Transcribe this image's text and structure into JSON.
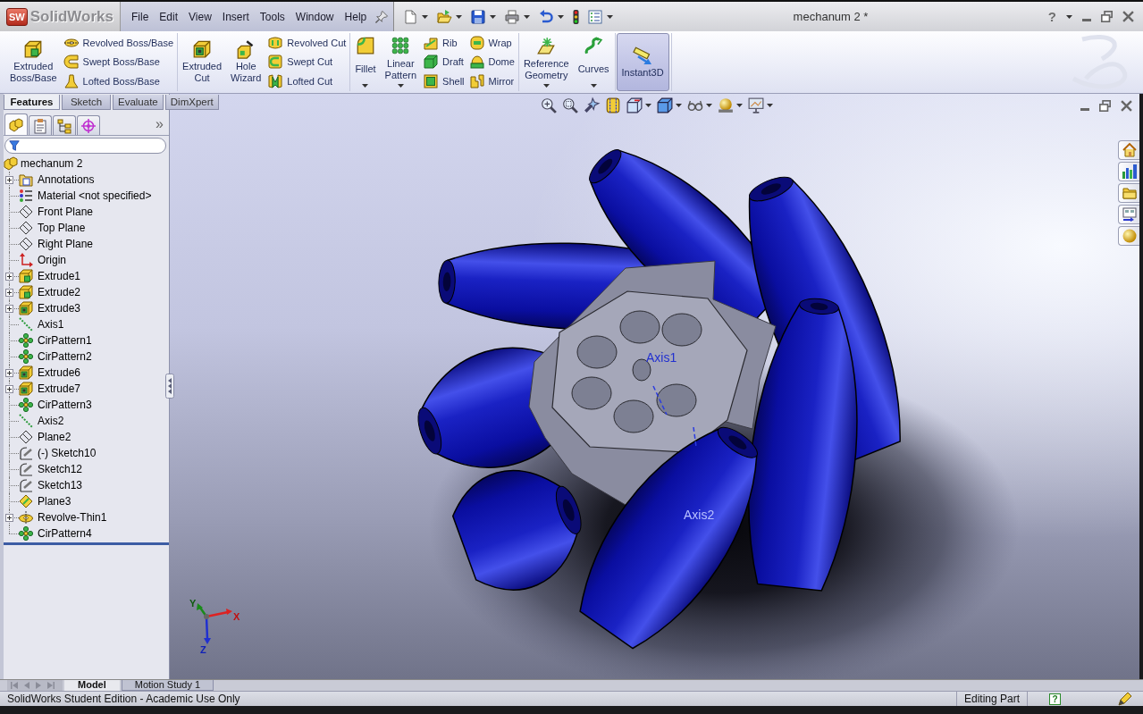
{
  "app": {
    "logo_mark": "SW",
    "logo": "SolidWorks"
  },
  "menu": [
    "File",
    "Edit",
    "View",
    "Insert",
    "Tools",
    "Window",
    "Help"
  ],
  "window": {
    "title": "mechanum 2 *",
    "help_glyph": "?"
  },
  "ribbon": {
    "groups": [
      {
        "columns": [
          {
            "kind": "large",
            "label": "Extruded Boss/Base",
            "dropdown": false,
            "active": false
          },
          {
            "kind": "stack",
            "items": [
              "Revolved Boss/Base",
              "Swept Boss/Base",
              "Lofted Boss/Base"
            ]
          }
        ]
      },
      {
        "columns": [
          {
            "kind": "large",
            "label": "Extruded Cut",
            "dropdown": false,
            "active": false
          },
          {
            "kind": "large",
            "label": "Hole Wizard",
            "dropdown": false,
            "active": false
          },
          {
            "kind": "stack",
            "items": [
              "Revolved Cut",
              "Swept Cut",
              "Lofted Cut"
            ]
          }
        ]
      },
      {
        "columns": [
          {
            "kind": "large",
            "label": "Fillet",
            "dropdown": true,
            "active": false
          },
          {
            "kind": "large",
            "label": "Linear Pattern",
            "dropdown": true,
            "active": false
          },
          {
            "kind": "stack",
            "items": [
              "Rib",
              "Draft",
              "Shell"
            ]
          },
          {
            "kind": "stack",
            "items": [
              "Wrap",
              "Dome",
              "Mirror"
            ]
          }
        ]
      },
      {
        "columns": [
          {
            "kind": "large",
            "label": "Reference Geometry",
            "dropdown": true,
            "active": false
          },
          {
            "kind": "large",
            "label": "Curves",
            "dropdown": true,
            "active": false
          }
        ]
      },
      {
        "columns": [
          {
            "kind": "large",
            "label": "Instant3D",
            "dropdown": false,
            "active": true
          }
        ]
      }
    ]
  },
  "command_tabs": [
    {
      "label": "Features",
      "selected": true
    },
    {
      "label": "Sketch",
      "selected": false
    },
    {
      "label": "Evaluate",
      "selected": false
    },
    {
      "label": "DimXpert",
      "selected": false
    }
  ],
  "feature_panel": {
    "tabs": [
      {
        "selected": true
      },
      {
        "selected": false
      },
      {
        "selected": false
      },
      {
        "selected": false
      }
    ],
    "more_glyph": "»",
    "tree": {
      "label": "mechanum 2",
      "children": [
        {
          "label": "Annotations",
          "kind": "annotations",
          "expandable": true
        },
        {
          "label": "Material <not specified>",
          "kind": "material",
          "expandable": false
        },
        {
          "label": "Front Plane",
          "kind": "plane",
          "expandable": false
        },
        {
          "label": "Top Plane",
          "kind": "plane",
          "expandable": false
        },
        {
          "label": "Right Plane",
          "kind": "plane",
          "expandable": false
        },
        {
          "label": "Origin",
          "kind": "origin",
          "expandable": false
        },
        {
          "label": "Extrude1",
          "kind": "boss",
          "expandable": true
        },
        {
          "label": "Extrude2",
          "kind": "boss",
          "expandable": true
        },
        {
          "label": "Extrude3",
          "kind": "cut",
          "expandable": true
        },
        {
          "label": "Axis1",
          "kind": "axis",
          "expandable": false
        },
        {
          "label": "CirPattern1",
          "kind": "pattern",
          "expandable": false
        },
        {
          "label": "CirPattern2",
          "kind": "pattern",
          "expandable": false
        },
        {
          "label": "Extrude6",
          "kind": "cut",
          "expandable": true
        },
        {
          "label": "Extrude7",
          "kind": "cut",
          "expandable": true
        },
        {
          "label": "CirPattern3",
          "kind": "pattern",
          "expandable": false
        },
        {
          "label": "Axis2",
          "kind": "axis",
          "expandable": false
        },
        {
          "label": "Plane2",
          "kind": "plane",
          "expandable": false
        },
        {
          "label": "(-) Sketch10",
          "kind": "sketch",
          "expandable": false
        },
        {
          "label": "Sketch12",
          "kind": "sketch",
          "expandable": false
        },
        {
          "label": "Sketch13",
          "kind": "sketch",
          "expandable": false
        },
        {
          "label": "Plane3",
          "kind": "shownplane",
          "expandable": false
        },
        {
          "label": "Revolve-Thin1",
          "kind": "revolve",
          "expandable": true
        },
        {
          "label": "CirPattern4",
          "kind": "pattern",
          "expandable": false
        }
      ]
    }
  },
  "viewport": {
    "axis_labels": [
      "Axis1",
      "Axis2"
    ],
    "triad": {
      "x": "X",
      "y": "Y",
      "z": "Z"
    }
  },
  "bottom_tabs": [
    {
      "label": "Model",
      "selected": true
    },
    {
      "label": "Motion Study 1",
      "selected": false
    }
  ],
  "status_bar": {
    "message": "SolidWorks Student Edition - Academic Use Only",
    "mode": "Editing Part",
    "help_glyph": "?"
  }
}
